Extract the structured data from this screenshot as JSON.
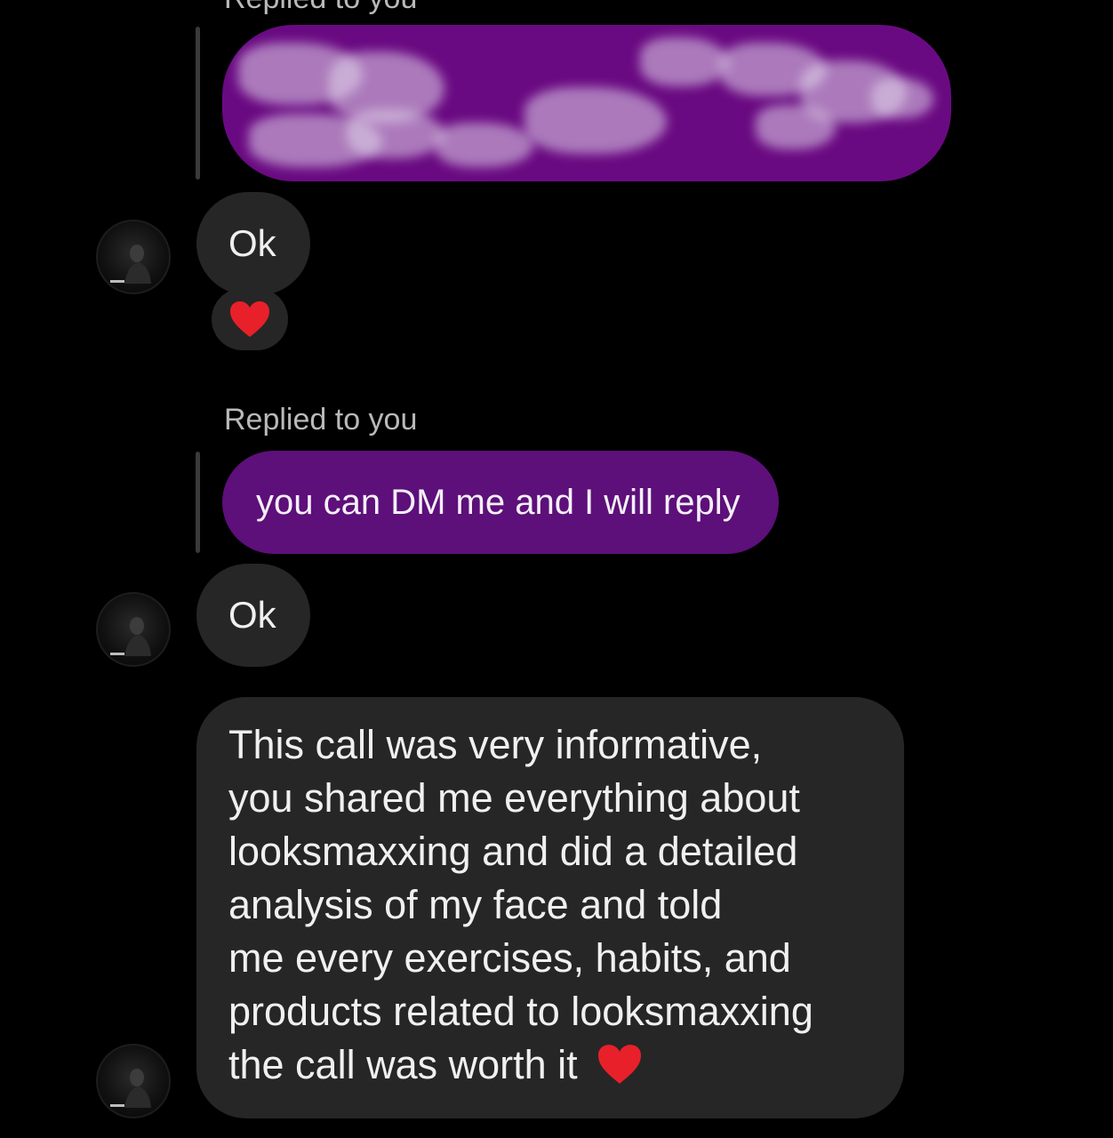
{
  "thread": {
    "reply_label_top": "Replied to you",
    "reply_label": "Replied to you",
    "ok_message_1": "Ok",
    "reaction_icon": "red-heart-icon",
    "replied_message": "you can DM me and I will reply",
    "ok_message_2": "Ok",
    "long_message_lines": [
      "This call was very informative,",
      "you shared me everything about",
      "looksmaxxing and did a detailed",
      "analysis of my face and told",
      "me every exercises, habits, and",
      "products related to looksmaxxing",
      "the call was worth it"
    ],
    "long_message_emoji": "red-heart-icon"
  },
  "colors": {
    "background": "#000000",
    "sent_bubble": "#5d0f7a",
    "received_bubble": "#262626",
    "heart": "#e8202a"
  }
}
